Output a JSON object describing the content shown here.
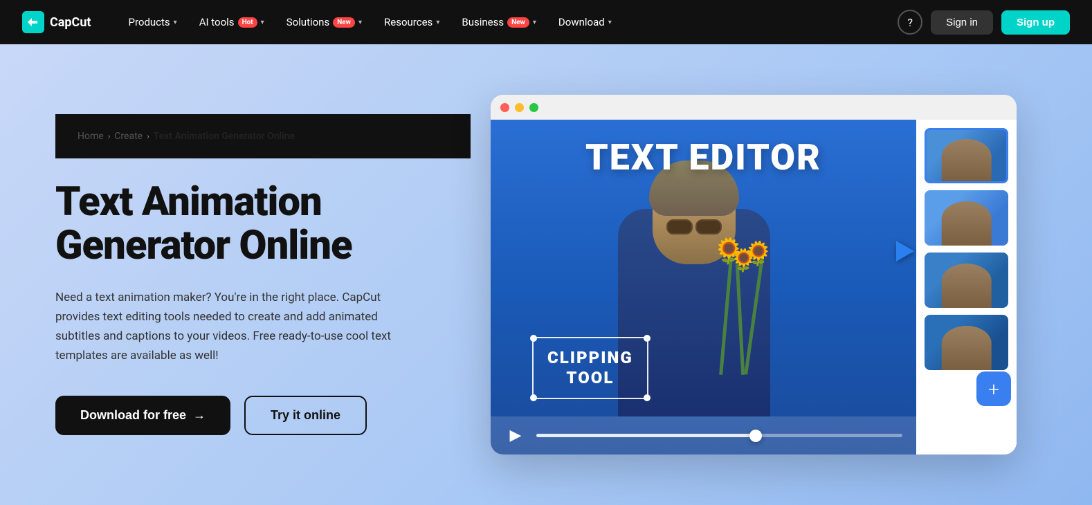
{
  "logo": {
    "text": "CapCut"
  },
  "nav": {
    "items": [
      {
        "id": "products",
        "label": "Products",
        "has_chevron": true,
        "badge": null
      },
      {
        "id": "ai-tools",
        "label": "AI tools",
        "has_chevron": true,
        "badge": "Hot",
        "badge_type": "hot"
      },
      {
        "id": "solutions",
        "label": "Solutions",
        "has_chevron": true,
        "badge": "New",
        "badge_type": "new"
      },
      {
        "id": "resources",
        "label": "Resources",
        "has_chevron": true,
        "badge": null
      },
      {
        "id": "business",
        "label": "Business",
        "has_chevron": true,
        "badge": "New",
        "badge_type": "new"
      },
      {
        "id": "download",
        "label": "Download",
        "has_chevron": true,
        "badge": null
      }
    ],
    "signin_label": "Sign in",
    "signup_label": "Sign up",
    "help_icon": "?"
  },
  "breadcrumb": {
    "home": "Home",
    "create": "Create",
    "current": "Text Animation Generator Online"
  },
  "hero": {
    "title": "Text Animation Generator Online",
    "description": "Need a text animation maker? You're in the right place. CapCut provides text editing tools needed to create and add animated subtitles and captions to your videos. Free ready-to-use cool text templates are available as well!",
    "btn_download": "Download for free",
    "btn_download_arrow": "→",
    "btn_try": "Try it online"
  },
  "illustration": {
    "window_dots": [
      "red",
      "yellow",
      "green"
    ],
    "video_label": "TEXT EDITOR",
    "clipping_tool_line1": "CLIPPING",
    "clipping_tool_line2": "TOOL",
    "play_icon": "▶",
    "add_icon": "+",
    "thumbnails": [
      {
        "id": 1
      },
      {
        "id": 2
      },
      {
        "id": 3
      },
      {
        "id": 4
      }
    ]
  },
  "colors": {
    "nav_bg": "#111111",
    "hero_bg_start": "#c8d8f8",
    "hero_bg_end": "#90b8f0",
    "btn_download_bg": "#111111",
    "btn_signup_bg": "#00d4c8",
    "accent_blue": "#2b7fef"
  }
}
